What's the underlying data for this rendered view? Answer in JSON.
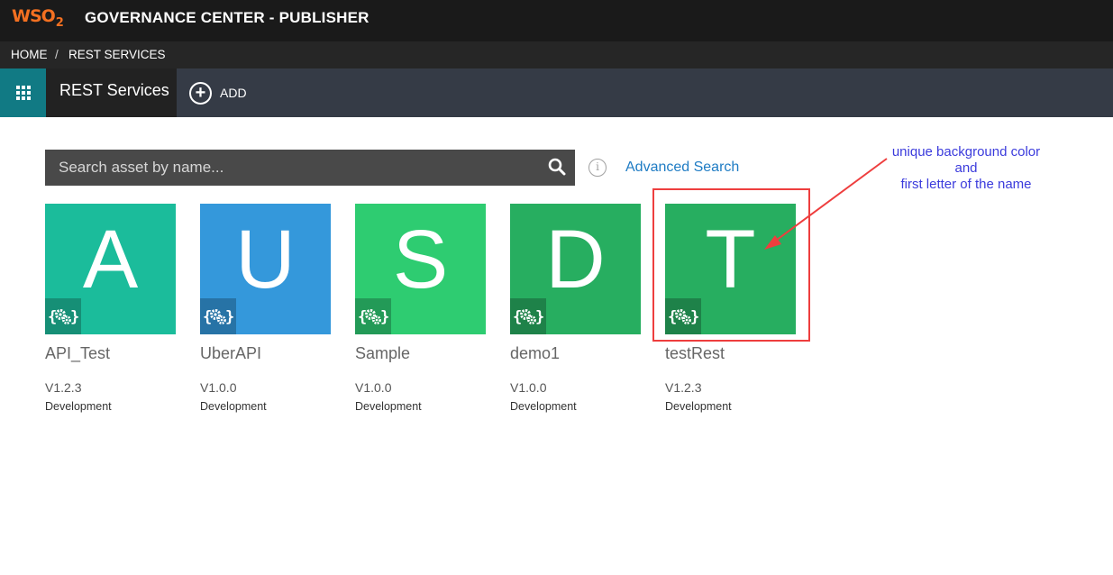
{
  "header": {
    "logo_text": "WSO",
    "logo_sub": "2",
    "title": "GOVERNANCE CENTER - PUBLISHER"
  },
  "breadcrumb": {
    "items": [
      "HOME",
      "REST SERVICES"
    ],
    "separator": "/"
  },
  "toolbar": {
    "menu_icon": "grid-icon",
    "section_title": "REST Services",
    "add_label": "ADD",
    "add_icon": "plus-circle-icon"
  },
  "search": {
    "placeholder": "Search asset by name...",
    "value": "",
    "advanced_label": "Advanced Search",
    "icon": "search-icon"
  },
  "assets": [
    {
      "letter": "A",
      "name": "API_Test",
      "version": "V1.2.3",
      "lifecycle": "Development",
      "color": "#1bbc9b",
      "badge_color": "#168f76"
    },
    {
      "letter": "U",
      "name": "UberAPI",
      "version": "V1.0.0",
      "lifecycle": "Development",
      "color": "#3498db",
      "badge_color": "#2773a6"
    },
    {
      "letter": "S",
      "name": "Sample",
      "version": "V1.0.0",
      "lifecycle": "Development",
      "color": "#2ecc71",
      "badge_color": "#239a57"
    },
    {
      "letter": "D",
      "name": "demo1",
      "version": "V1.0.0",
      "lifecycle": "Development",
      "color": "#27ae60",
      "badge_color": "#1e8249"
    },
    {
      "letter": "T",
      "name": "testRest",
      "version": "V1.2.3",
      "lifecycle": "Development",
      "color": "#27ae60",
      "badge_color": "#1e8249"
    }
  ],
  "annotation": {
    "lines": [
      "unique background color",
      "and",
      "first letter of the name"
    ],
    "color": "#3b3bdc",
    "highlight_color": "#ee3e3e"
  }
}
